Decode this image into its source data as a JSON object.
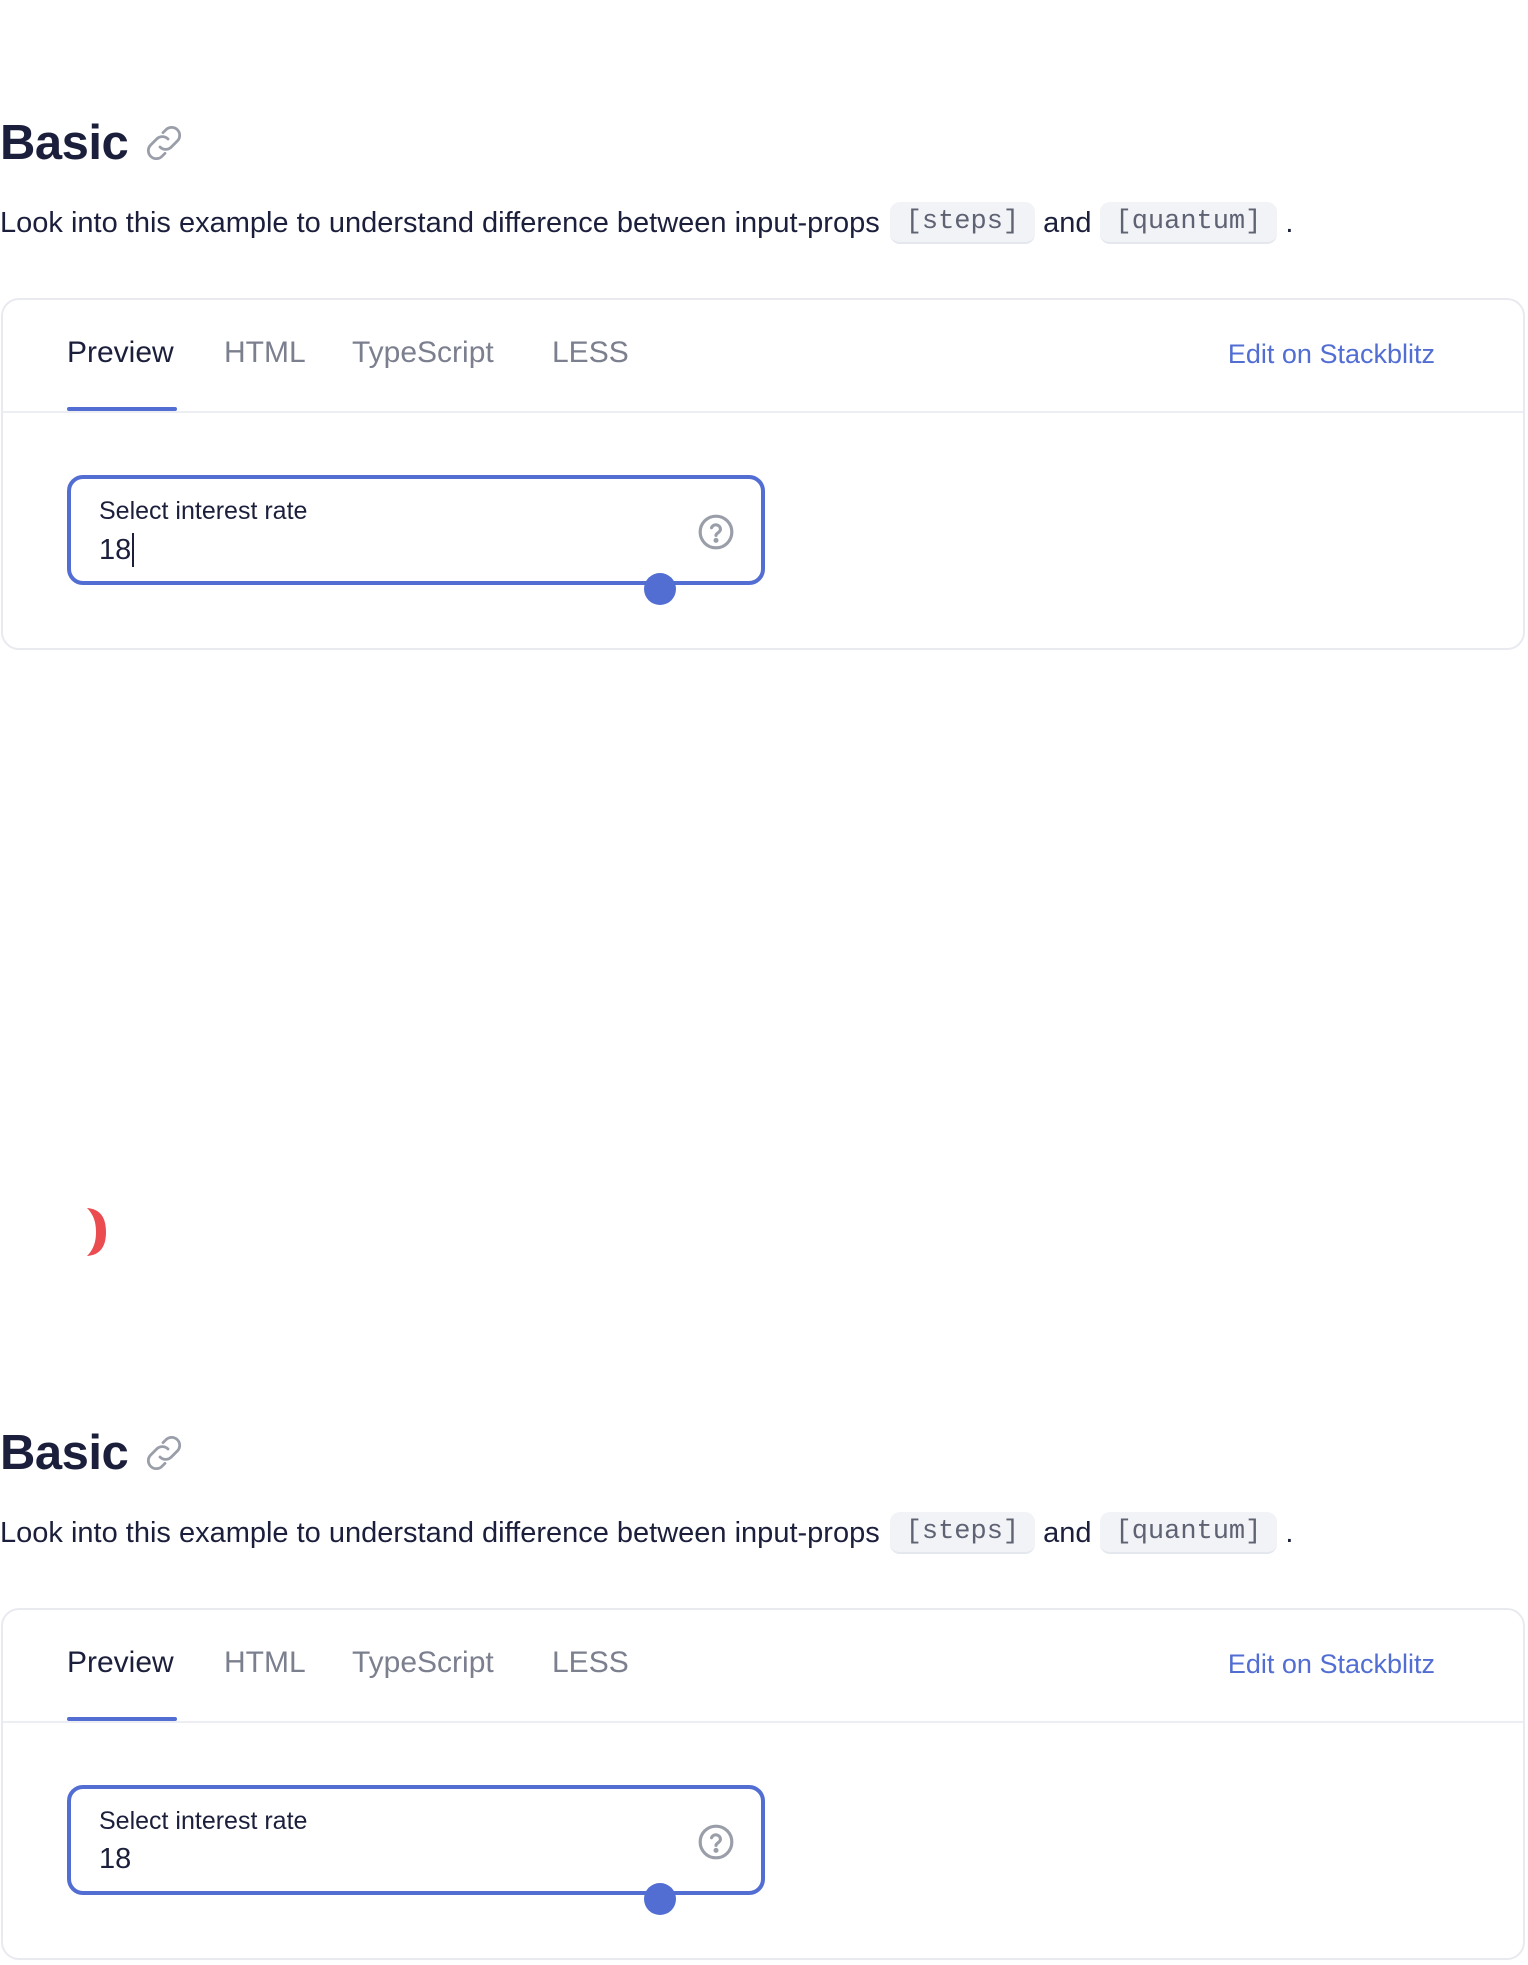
{
  "sections": [
    {
      "title": "Basic",
      "desc_before": "Look into this example to understand difference between input-props",
      "code1": "[steps]",
      "and": "and",
      "code2": "[quantum]",
      "period": ".",
      "tabs": [
        "Preview",
        "HTML",
        "TypeScript",
        "LESS"
      ],
      "active_tab": "Preview",
      "edit_link": "Edit on Stackblitz",
      "field": {
        "label": "Select interest rate",
        "value": "18",
        "slider_fraction": 0.85
      }
    },
    {
      "title": "Basic",
      "desc_before": "Look into this example to understand difference between input-props",
      "code1": "[steps]",
      "and": "and",
      "code2": "[quantum]",
      "period": ".",
      "tabs": [
        "Preview",
        "HTML",
        "TypeScript",
        "LESS"
      ],
      "active_tab": "Preview",
      "edit_link": "Edit on Stackblitz",
      "field": {
        "label": "Select interest rate",
        "value": "18",
        "slider_fraction": 0.85
      }
    }
  ],
  "icons": {
    "anchor": "link-icon",
    "help": "help-circle-icon"
  },
  "colors": {
    "accent": "#526ed3",
    "text": "#1b1f3b",
    "muted": "#7b7f8e",
    "red_mark": "#e8383d"
  }
}
